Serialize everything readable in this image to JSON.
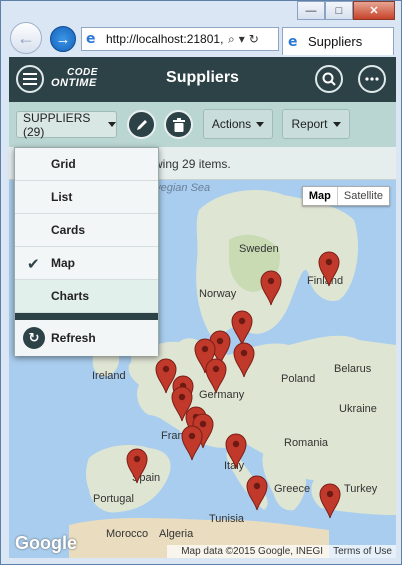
{
  "browser": {
    "address": "http://localhost:21801,",
    "tab_label": "Suppliers",
    "controls": {
      "minimize": "—",
      "maximize": "□",
      "close": "✕"
    }
  },
  "app": {
    "title": "Suppliers",
    "logo_line1": "CODE",
    "logo_line2": "ONTIME"
  },
  "toolbar": {
    "view_selector": "SUPPLIERS (29)",
    "actions_label": "Actions",
    "report_label": "Report"
  },
  "info": {
    "text": "wing 29 items."
  },
  "dropdown": {
    "items": [
      {
        "label": "Grid",
        "checked": false
      },
      {
        "label": "List",
        "checked": false
      },
      {
        "label": "Cards",
        "checked": false
      },
      {
        "label": "Map",
        "checked": true
      },
      {
        "label": "Charts",
        "checked": false
      }
    ],
    "refresh_label": "Refresh"
  },
  "map": {
    "type_buttons": [
      "Map",
      "Satellite"
    ],
    "labels": {
      "sea": "rwegian Sea",
      "sweden": "Sweden",
      "finland": "Finland",
      "norway": "Norway",
      "ireland": "Ireland",
      "poland": "Poland",
      "belarus": "Belarus",
      "ukraine": "Ukraine",
      "germany": "Germany",
      "france": "France",
      "romania": "Romania",
      "italy": "Italy",
      "spain": "Spain",
      "portugal": "Portugal",
      "greece": "Greece",
      "turkey": "Turkey",
      "morocco": "Morocco",
      "algeria": "Algeria",
      "tunisia": "Tunisia"
    },
    "google": "Google",
    "attribution": "Map data ©2015 Google, INEGI",
    "terms": "Terms of Use",
    "pin_color": "#c0392b"
  }
}
